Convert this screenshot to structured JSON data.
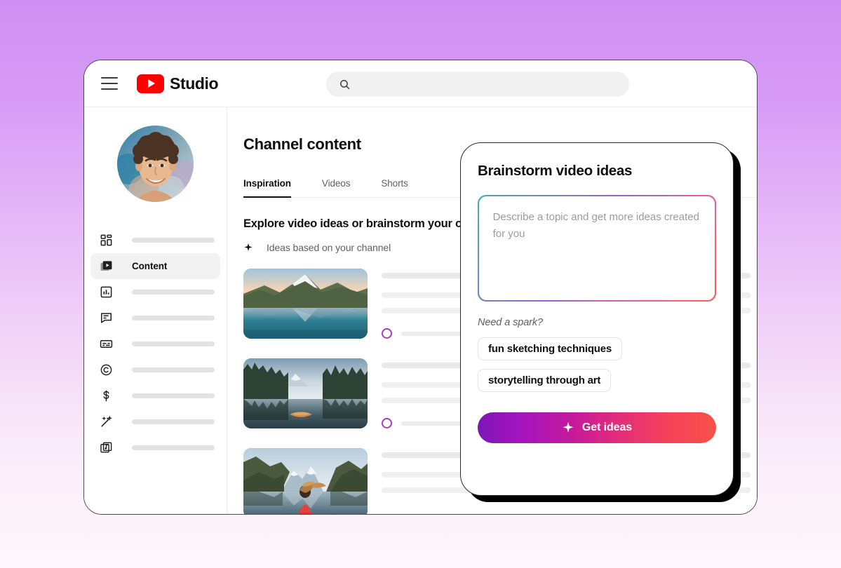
{
  "window": {
    "header": {
      "menu_icon": "hamburger-menu-icon",
      "logo_icon": "youtube-logo-icon",
      "brand": "Studio",
      "search": {
        "icon": "search-icon",
        "value": "",
        "placeholder": ""
      }
    },
    "sidebar": {
      "avatar_alt": "channel-avatar",
      "items": [
        {
          "icon": "dashboard-icon",
          "label": "",
          "skeleton_width": 118,
          "active": false
        },
        {
          "icon": "content-icon",
          "label": "Content",
          "skeleton_width": 0,
          "active": true
        },
        {
          "icon": "analytics-icon",
          "label": "",
          "skeleton_width": 118,
          "active": false
        },
        {
          "icon": "comments-icon",
          "label": "",
          "skeleton_width": 118,
          "active": false
        },
        {
          "icon": "subtitles-icon",
          "label": "",
          "skeleton_width": 118,
          "active": false
        },
        {
          "icon": "copyright-icon",
          "label": "",
          "skeleton_width": 118,
          "active": false
        },
        {
          "icon": "earn-dollar-icon",
          "label": "",
          "skeleton_width": 118,
          "active": false
        },
        {
          "icon": "customization-wand-icon",
          "label": "",
          "skeleton_width": 118,
          "active": false
        },
        {
          "icon": "audio-library-icon",
          "label": "",
          "skeleton_width": 118,
          "active": false
        }
      ]
    },
    "main": {
      "page_title": "Channel content",
      "tabs": [
        {
          "label": "Inspiration",
          "active": true
        },
        {
          "label": "Videos",
          "active": false
        },
        {
          "label": "Shorts",
          "active": false
        }
      ],
      "section_heading": "Explore video ideas or brainstorm your own",
      "subheading": {
        "icon": "sparkle-icon",
        "text": "Ideas based on your channel"
      },
      "cards": [
        {
          "thumbnail": "matterhorn-lake-reflection-thumbnail",
          "lines": [
            98,
            70,
            88
          ],
          "meta_icon": "progress-ring-icon",
          "meta_width": 98
        },
        {
          "thumbnail": "boat-on-forest-lake-thumbnail",
          "lines": [
            98,
            70,
            88
          ],
          "meta_icon": "progress-ring-icon",
          "meta_width": 98
        },
        {
          "thumbnail": "hiker-red-jacket-mountain-lake-thumbnail",
          "lines": [
            98,
            70,
            88
          ],
          "meta_icon": "progress-ring-icon",
          "meta_width": 98
        }
      ]
    }
  },
  "modal": {
    "title": "Brainstorm video ideas",
    "textarea": {
      "value": "",
      "placeholder": "Describe a topic and get more ideas created for you"
    },
    "spark_label": "Need a spark?",
    "chips": [
      "fun sketching techniques",
      "storytelling through art"
    ],
    "cta": {
      "icon": "sparkle-icon",
      "label": "Get ideas"
    }
  },
  "colors": {
    "background_top": "#cf8ef2",
    "background_bottom": "#fdf7fc",
    "youtube_red": "#ff0000",
    "cta_gradient_start": "#7d16b5",
    "cta_gradient_mid": "#e22c7c",
    "cta_gradient_end": "#f85248",
    "field_border_gradient_start": "#4aa9b8",
    "field_border_gradient_end": "#fb5a5a",
    "progress_ring": "#a23fb8",
    "active_nav_bg": "#f2f2f2"
  }
}
